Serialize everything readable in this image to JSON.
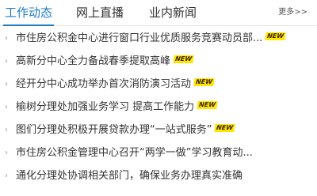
{
  "tabs": [
    {
      "label": "工作动态",
      "active": true
    },
    {
      "label": "网上直播",
      "active": false
    },
    {
      "label": "业内新闻",
      "active": false
    }
  ],
  "more_label": "更多>>",
  "accent_color": "#1f7bc4",
  "badge_color": "#ffe600",
  "news": [
    {
      "title": "市住房公积金中心进行窗口行业优质服务竞赛动员部...",
      "badge": "NEW"
    },
    {
      "title": "高新分中心全力备战春季提取高峰",
      "badge": "NEW"
    },
    {
      "title": "经开分中心成功举办首次消防演习活动",
      "badge": "NEW"
    },
    {
      "title": "榆树分理处加强业务学习 提高工作能力",
      "badge": "NEW"
    },
    {
      "title": "图们分理处积极开展贷款办理“一站式服务”",
      "badge": "NEW"
    },
    {
      "title": "市住房公积金管理中心召开“两学一做”学习教育动...",
      "badge": ""
    },
    {
      "title": "通化分理处协调相关部门，确保业务办理真实准确",
      "badge": ""
    }
  ]
}
